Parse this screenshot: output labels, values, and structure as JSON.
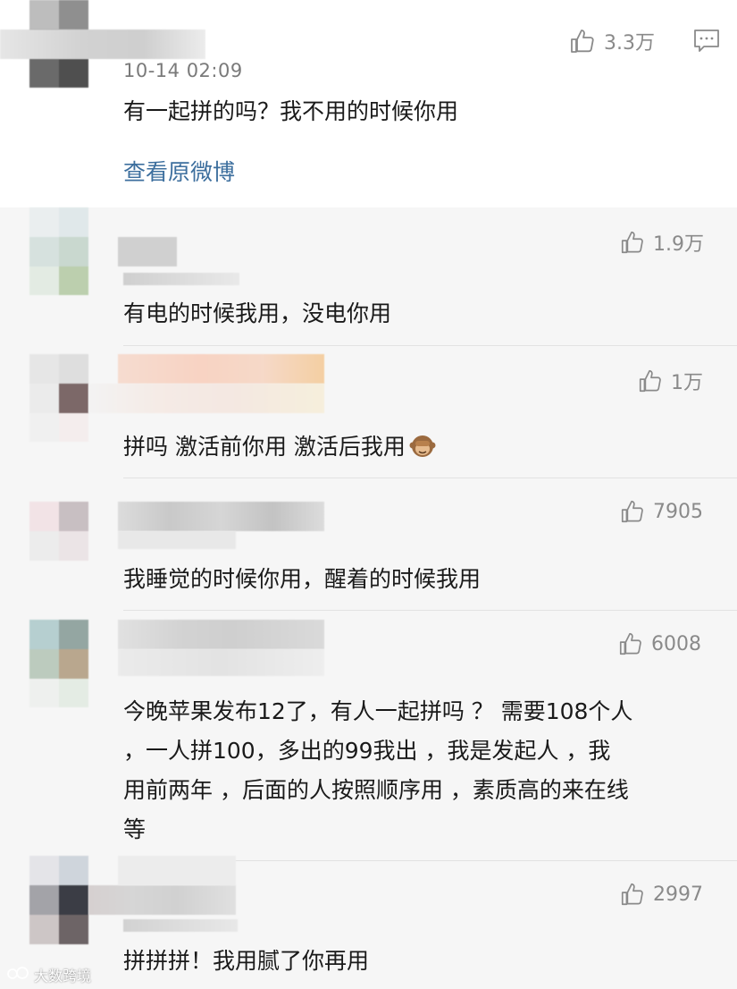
{
  "post": {
    "timestamp": "10-14 02:09",
    "text": "有一起拼的吗？我不用的时候你用",
    "likes": "3.3万",
    "view_original": "查看原微博"
  },
  "comments": [
    {
      "likes": "1.9万",
      "text": "有电的时候我用，没电你用"
    },
    {
      "likes": "1万",
      "text": "拼吗  激活前你用  激活后我用"
    },
    {
      "likes": "7905",
      "text": "我睡觉的时候你用，醒着的时候我用"
    },
    {
      "likes": "6008",
      "lines": [
        "今晚苹果发布12了，有人一起拼吗 ？ 需要108个人",
        "，一人拼100，多出的99我出 ，我是发起人 ，我",
        "用前两年 ，后面的人按照顺序用 ，素质高的来在线",
        "等"
      ]
    },
    {
      "likes": "2997",
      "text": "拼拼拼！我用腻了你再用"
    }
  ],
  "watermark": "大数跨境",
  "icons": {
    "like": "thumbs-up-icon",
    "comment": "comment-icon",
    "monkey": "see-no-evil-monkey-emoji"
  }
}
